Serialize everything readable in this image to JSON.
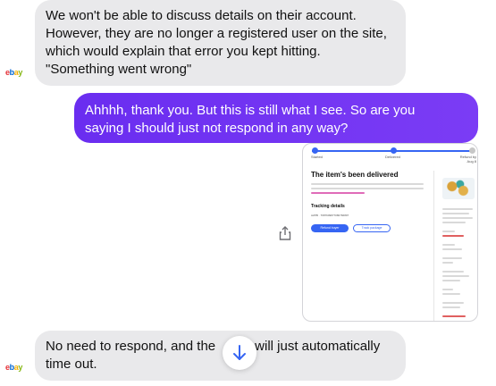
{
  "messages": [
    {
      "sender": "ebay",
      "lines": [
        "We won't be able to discuss details on their account.",
        "However, they are no longer a registered user on the site,",
        "which would explain that error you kept hitting.",
        "\"Something went wrong\""
      ]
    },
    {
      "sender": "user",
      "lines": [
        "Ahhhh, thank you.   But this is still what I see.  So are you",
        "saying I should just not respond in any way?"
      ]
    },
    {
      "sender": "ebay",
      "lines": [
        "No need to respond, and the",
        "will just automatically",
        "time out."
      ]
    }
  ],
  "avatar": {
    "letters": [
      "e",
      "b",
      "a",
      "y"
    ]
  },
  "attachment": {
    "steps": [
      "Started",
      "Delivered",
      "Refund by Aug 8"
    ],
    "heading": "The item's been delivered",
    "tracking_heading": "Tracking details",
    "tracking_number": "AZPB · 7687609877080766897",
    "primary_button": "Refund buyer",
    "secondary_button": "Track package"
  },
  "icons": {
    "share": "share-icon",
    "scroll": "arrow-down-icon"
  },
  "colors": {
    "outgoing_bubble": "#6a2df0",
    "incoming_bubble": "#e9e9eb",
    "accent": "#3665f3"
  }
}
